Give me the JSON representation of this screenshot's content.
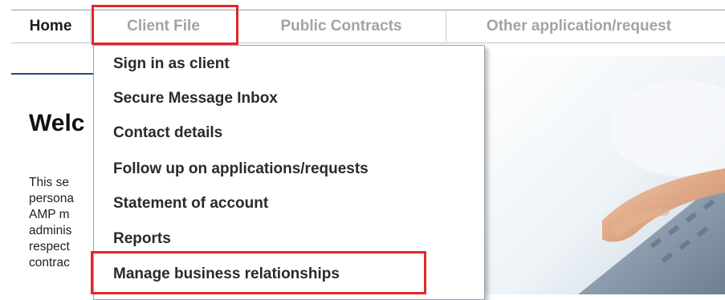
{
  "nav": {
    "items": [
      {
        "label": "Home",
        "active": true
      },
      {
        "label": "Client File",
        "active": false,
        "highlighted": true
      },
      {
        "label": "Public Contracts",
        "active": false
      },
      {
        "label": "Other application/request",
        "active": false
      }
    ]
  },
  "dropdown": {
    "items": [
      {
        "label": "Sign in as client"
      },
      {
        "label": "Secure Message Inbox"
      },
      {
        "label": "Contact details"
      },
      {
        "label": "Follow up on applications/requests"
      },
      {
        "label": "Statement of account"
      },
      {
        "label": "Reports"
      },
      {
        "label": "Manage business relationships",
        "highlighted": true
      }
    ]
  },
  "main": {
    "welcome": "Welc",
    "intro": "This se\npersona\nAMP m\nadminis\nrespect\ncontrac"
  },
  "colors": {
    "highlight": "#e2262b",
    "rule": "#1f4f82",
    "inactive_nav": "#a3a3a3"
  }
}
